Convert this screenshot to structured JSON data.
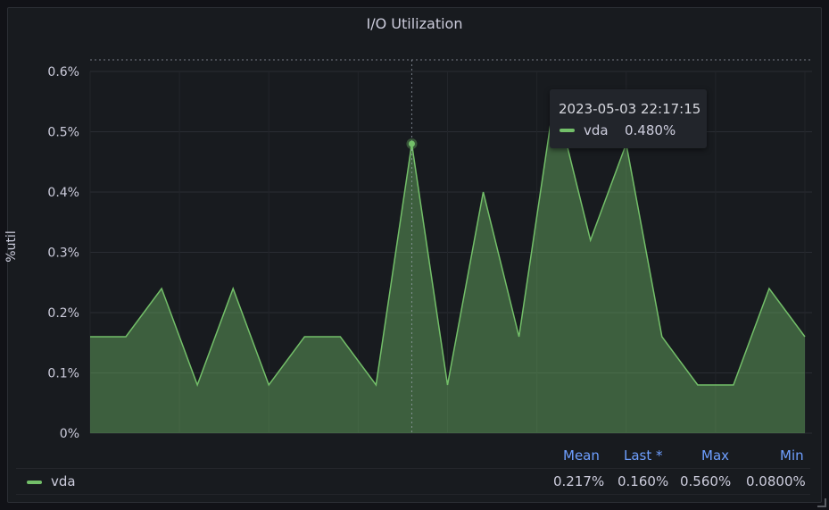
{
  "panel": {
    "title": "I/O Utilization"
  },
  "chart_data": {
    "type": "area",
    "title": "I/O Utilization",
    "ylabel": "%util",
    "xlabel": "",
    "ylim": [
      0,
      0.6
    ],
    "yticks": [
      "0%",
      "0.1%",
      "0.2%",
      "0.3%",
      "0.4%",
      "0.5%",
      "0.6%"
    ],
    "grid": true,
    "legend_placement": "bottom",
    "series": [
      {
        "name": "vda",
        "color": "#73bf69",
        "values": [
          0.16,
          0.16,
          0.24,
          0.08,
          0.24,
          0.08,
          0.16,
          0.16,
          0.08,
          0.48,
          0.08,
          0.4,
          0.16,
          0.56,
          0.32,
          0.48,
          0.16,
          0.08,
          0.08,
          0.24,
          0.16
        ]
      }
    ],
    "hover_index": 9
  },
  "tooltip": {
    "time": "2023-05-03 22:17:15",
    "series": "vda",
    "value": "0.480%"
  },
  "legend": {
    "headers": {
      "mean": "Mean",
      "last": "Last *",
      "max": "Max",
      "min": "Min"
    },
    "rows": [
      {
        "name": "vda",
        "mean": "0.217%",
        "last": "0.160%",
        "max": "0.560%",
        "min": "0.0800%"
      }
    ]
  }
}
